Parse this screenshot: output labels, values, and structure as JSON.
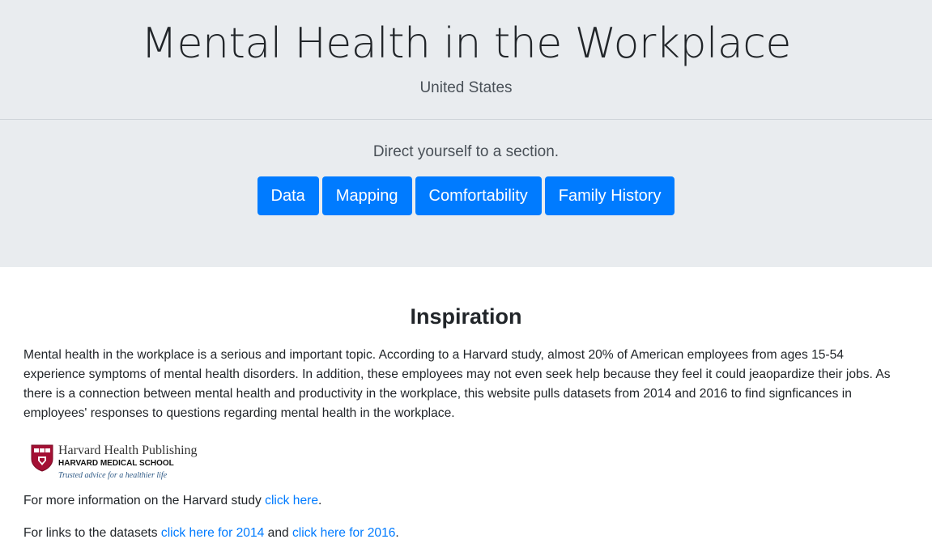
{
  "header": {
    "title": "Mental Health in the Workplace",
    "subtitle": "United States",
    "prompt": "Direct yourself to a section."
  },
  "nav": {
    "buttons": [
      "Data",
      "Mapping",
      "Comfortability",
      "Family History"
    ]
  },
  "main": {
    "heading": "Inspiration",
    "paragraph": "Mental health in the workplace is a serious and important topic. According to a Harvard study, almost 20% of American employees from ages 15-54 experience symptoms of mental health disorders. In addition, these employees may not even seek help because they feel it could jeaopardize their jobs. As there is a connection between mental health and productivity in the workplace, this website pulls datasets from 2014 and 2016 to find signficances in employees' responses to questions regarding mental health in the workplace.",
    "logo": {
      "line1": "Harvard Health Publishing",
      "line2": "HARVARD MEDICAL SCHOOL",
      "line3": "Trusted advice for a healthier life"
    },
    "more_info": {
      "prefix": "For more information on the Harvard study ",
      "link": "click here",
      "suffix": "."
    },
    "datasets": {
      "prefix": "For links to the datasets ",
      "link_2014": "click here for 2014",
      "middle": " and ",
      "link_2016": "click here for 2016",
      "suffix": "."
    }
  },
  "colors": {
    "jumbotron_bg": "#e9ecef",
    "button_bg": "#007bff",
    "link": "#007bff",
    "shield_red": "#a41034"
  }
}
